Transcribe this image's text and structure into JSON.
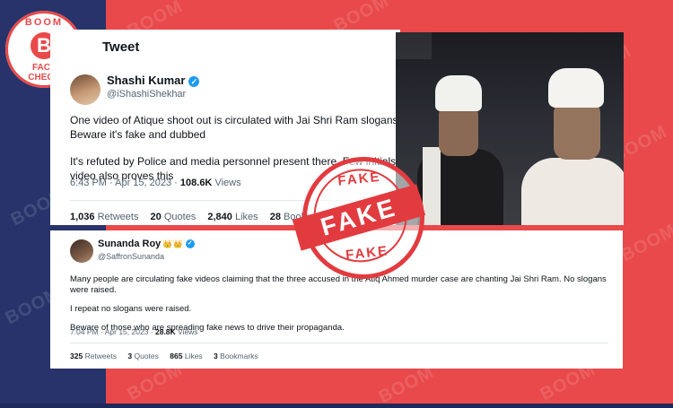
{
  "badge": {
    "top": "BOOM",
    "letter": "B",
    "bottom_line1": "FACT",
    "bottom_line2": "CHECK"
  },
  "watermark": "BOOM",
  "tweet1": {
    "header": "Tweet",
    "name": "Shashi Kumar",
    "handle": "@iShashiShekhar",
    "paragraph1": "One video of Atique shoot out is circulated with Jai Shri Ram slogans. Beware it's fake and dubbed",
    "paragraph2": "It's refuted by Police and media personnel present there. Few initials video also proves this",
    "time": "6:43 PM · Apr 15, 2023 · ",
    "views_count": "108.6K",
    "views_label": " Views",
    "stats": [
      {
        "count": "1,036",
        "label": "Retweets"
      },
      {
        "count": "20",
        "label": "Quotes"
      },
      {
        "count": "2,840",
        "label": "Likes"
      },
      {
        "count": "28",
        "label": "Bookmarks"
      }
    ]
  },
  "tweet2": {
    "name": "Sunanda Roy",
    "crown": "👑👑",
    "handle": "@SaffronSunanda",
    "paragraph1": "Many people are circulating fake videos claiming that the three accused in the Atiq Ahmed murder case are chanting Jai Shri Ram.  No slogans were raised.",
    "paragraph2": "I repeat no slogans were raised.",
    "paragraph3": "Beware of those who are spreading fake news to drive their propaganda.",
    "time": "7:04 PM · Apr 15, 2023 · ",
    "views_count": "28.8K",
    "views_label": " Views",
    "stats": [
      {
        "count": "325",
        "label": "Retweets"
      },
      {
        "count": "3",
        "label": "Quotes"
      },
      {
        "count": "865",
        "label": "Likes"
      },
      {
        "count": "3",
        "label": "Bookmarks"
      }
    ]
  },
  "stamp": {
    "top": "FAKE",
    "center": "FAKE",
    "bottom": "FAKE",
    "color": "#e23b3f"
  },
  "colors": {
    "boom_red": "#e9494a",
    "boom_navy": "#27336a",
    "twitter_blue": "#1d9bf0"
  }
}
